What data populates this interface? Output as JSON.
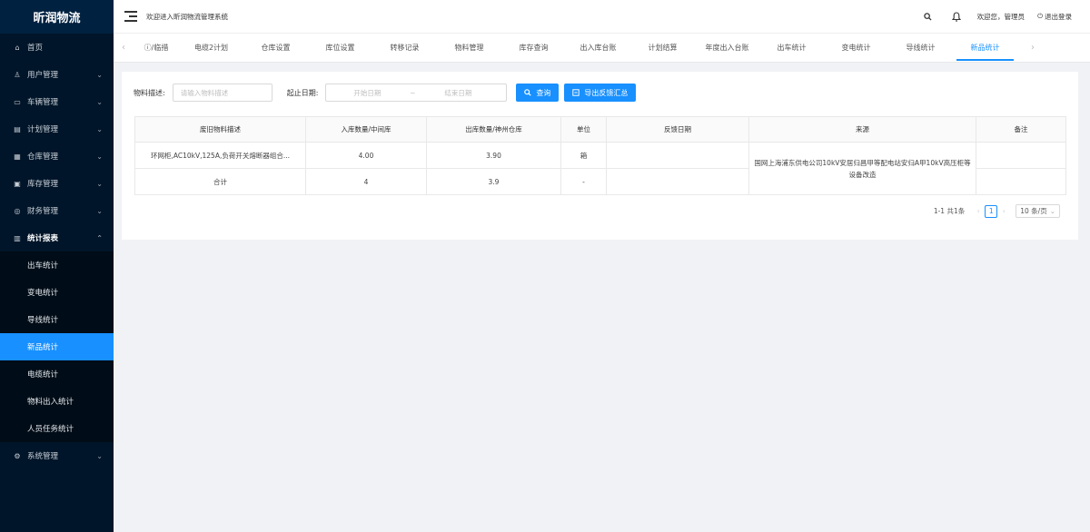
{
  "app": {
    "logo": "昕润物流"
  },
  "sidebar": {
    "items": [
      {
        "label": "首页",
        "icon": "home-icon"
      },
      {
        "label": "用户管理",
        "icon": "user-icon"
      },
      {
        "label": "车辆管理",
        "icon": "car-icon"
      },
      {
        "label": "计划管理",
        "icon": "document-icon"
      },
      {
        "label": "仓库管理",
        "icon": "warehouse-icon"
      },
      {
        "label": "库存管理",
        "icon": "inventory-icon"
      },
      {
        "label": "财务管理",
        "icon": "finance-icon"
      },
      {
        "label": "统计报表",
        "icon": "chart-icon"
      }
    ],
    "sub_items": [
      "出车统计",
      "变电统计",
      "导线统计",
      "新品统计",
      "电缆统计",
      "物料出入统计",
      "人员任务统计"
    ],
    "last_item": {
      "label": "系统管理",
      "icon": "gear-icon"
    }
  },
  "header": {
    "welcome": "欢迎进入昕润物流管理系统",
    "greeting": "欢迎您，管理员",
    "logout": "退出登录"
  },
  "tabs": [
    "ⓘ/临措",
    "电缆2计划",
    "仓库设置",
    "库位设置",
    "转移记录",
    "物料管理",
    "库存查询",
    "出入库台账",
    "计划结算",
    "年度出入台账",
    "出车统计",
    "变电统计",
    "导线统计",
    "新品统计"
  ],
  "filters": {
    "material_label": "物料描述:",
    "material_placeholder": "请输入物料描述",
    "date_label": "起止日期:",
    "start_placeholder": "开始日期",
    "range_sep": "~",
    "end_placeholder": "结束日期",
    "query_label": "查询",
    "export_label": "导出反馈汇总"
  },
  "table": {
    "headers": [
      "废旧物料描述",
      "入库数量/中间库",
      "出库数量/神州仓库",
      "单位",
      "反馈日期",
      "来源",
      "备注"
    ],
    "row": {
      "desc": "环网柜,AC10kV,125A,负荷开关熔断器组合...",
      "in_qty": "4.00",
      "out_qty": "3.90",
      "unit": "箱",
      "date": "",
      "source": "国网上海浦东供电公司10kV安居归昌甲等配电站安归A甲10kV高压柜等设备改造",
      "remark": ""
    },
    "total": {
      "desc": "合计",
      "in_qty": "4",
      "out_qty": "3.9",
      "unit": "-",
      "date": "",
      "remark": ""
    }
  },
  "pagination": {
    "summary": "1-1 共1条",
    "current": "1",
    "page_size": "10 条/页"
  }
}
